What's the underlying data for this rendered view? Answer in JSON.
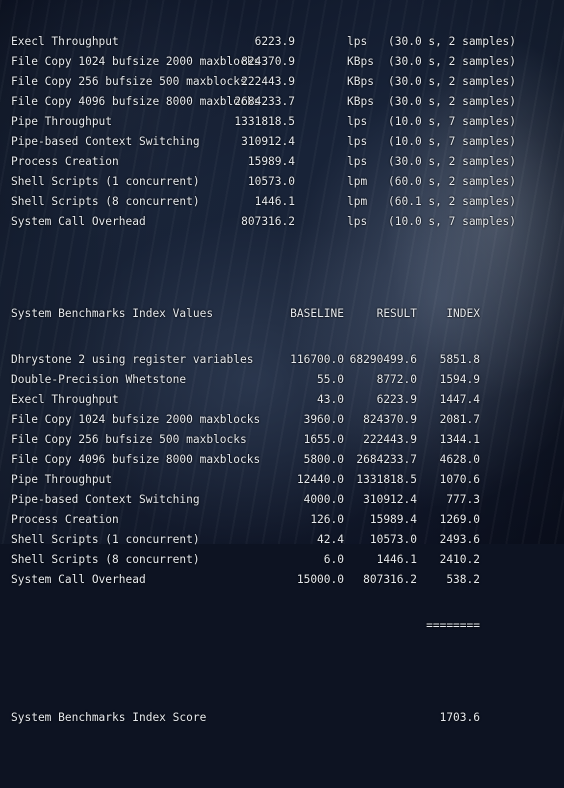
{
  "raw_results": [
    {
      "name": "Execl Throughput",
      "value": "6223.9",
      "unit": "lps",
      "info": "(30.0 s, 2 samples)"
    },
    {
      "name": "File Copy 1024 bufsize 2000 maxblocks",
      "value": "824370.9",
      "unit": "KBps",
      "info": "(30.0 s, 2 samples)"
    },
    {
      "name": "File Copy 256 bufsize 500 maxblocks",
      "value": "222443.9",
      "unit": "KBps",
      "info": "(30.0 s, 2 samples)"
    },
    {
      "name": "File Copy 4096 bufsize 8000 maxblocks",
      "value": "2684233.7",
      "unit": "KBps",
      "info": "(30.0 s, 2 samples)"
    },
    {
      "name": "Pipe Throughput",
      "value": "1331818.5",
      "unit": "lps",
      "info": "(10.0 s, 7 samples)"
    },
    {
      "name": "Pipe-based Context Switching",
      "value": "310912.4",
      "unit": "lps",
      "info": "(10.0 s, 7 samples)"
    },
    {
      "name": "Process Creation",
      "value": "15989.4",
      "unit": "lps",
      "info": "(30.0 s, 2 samples)"
    },
    {
      "name": "Shell Scripts (1 concurrent)",
      "value": "10573.0",
      "unit": "lpm",
      "info": "(60.0 s, 2 samples)"
    },
    {
      "name": "Shell Scripts (8 concurrent)",
      "value": "1446.1",
      "unit": "lpm",
      "info": "(60.1 s, 2 samples)"
    },
    {
      "name": "System Call Overhead",
      "value": "807316.2",
      "unit": "lps",
      "info": "(10.0 s, 7 samples)"
    }
  ],
  "index_header": {
    "title": "System Benchmarks Index Values",
    "baseline": "BASELINE",
    "result": "RESULT",
    "index": "INDEX"
  },
  "index_rows": [
    {
      "name": "Dhrystone 2 using register variables",
      "baseline": "116700.0",
      "result": "68290499.6",
      "index": "5851.8"
    },
    {
      "name": "Double-Precision Whetstone",
      "baseline": "55.0",
      "result": "8772.0",
      "index": "1594.9"
    },
    {
      "name": "Execl Throughput",
      "baseline": "43.0",
      "result": "6223.9",
      "index": "1447.4"
    },
    {
      "name": "File Copy 1024 bufsize 2000 maxblocks",
      "baseline": "3960.0",
      "result": "824370.9",
      "index": "2081.7"
    },
    {
      "name": "File Copy 256 bufsize 500 maxblocks",
      "baseline": "1655.0",
      "result": "222443.9",
      "index": "1344.1"
    },
    {
      "name": "File Copy 4096 bufsize 8000 maxblocks",
      "baseline": "5800.0",
      "result": "2684233.7",
      "index": "4628.0"
    },
    {
      "name": "Pipe Throughput",
      "baseline": "12440.0",
      "result": "1331818.5",
      "index": "1070.6"
    },
    {
      "name": "Pipe-based Context Switching",
      "baseline": "4000.0",
      "result": "310912.4",
      "index": "777.3"
    },
    {
      "name": "Process Creation",
      "baseline": "126.0",
      "result": "15989.4",
      "index": "1269.0"
    },
    {
      "name": "Shell Scripts (1 concurrent)",
      "baseline": "42.4",
      "result": "10573.0",
      "index": "2493.6"
    },
    {
      "name": "Shell Scripts (8 concurrent)",
      "baseline": "6.0",
      "result": "1446.1",
      "index": "2410.2"
    },
    {
      "name": "System Call Overhead",
      "baseline": "15000.0",
      "result": "807316.2",
      "index": "538.2"
    }
  ],
  "separator": "========",
  "score": {
    "label": "System Benchmarks Index Score",
    "value": "1703.6"
  }
}
